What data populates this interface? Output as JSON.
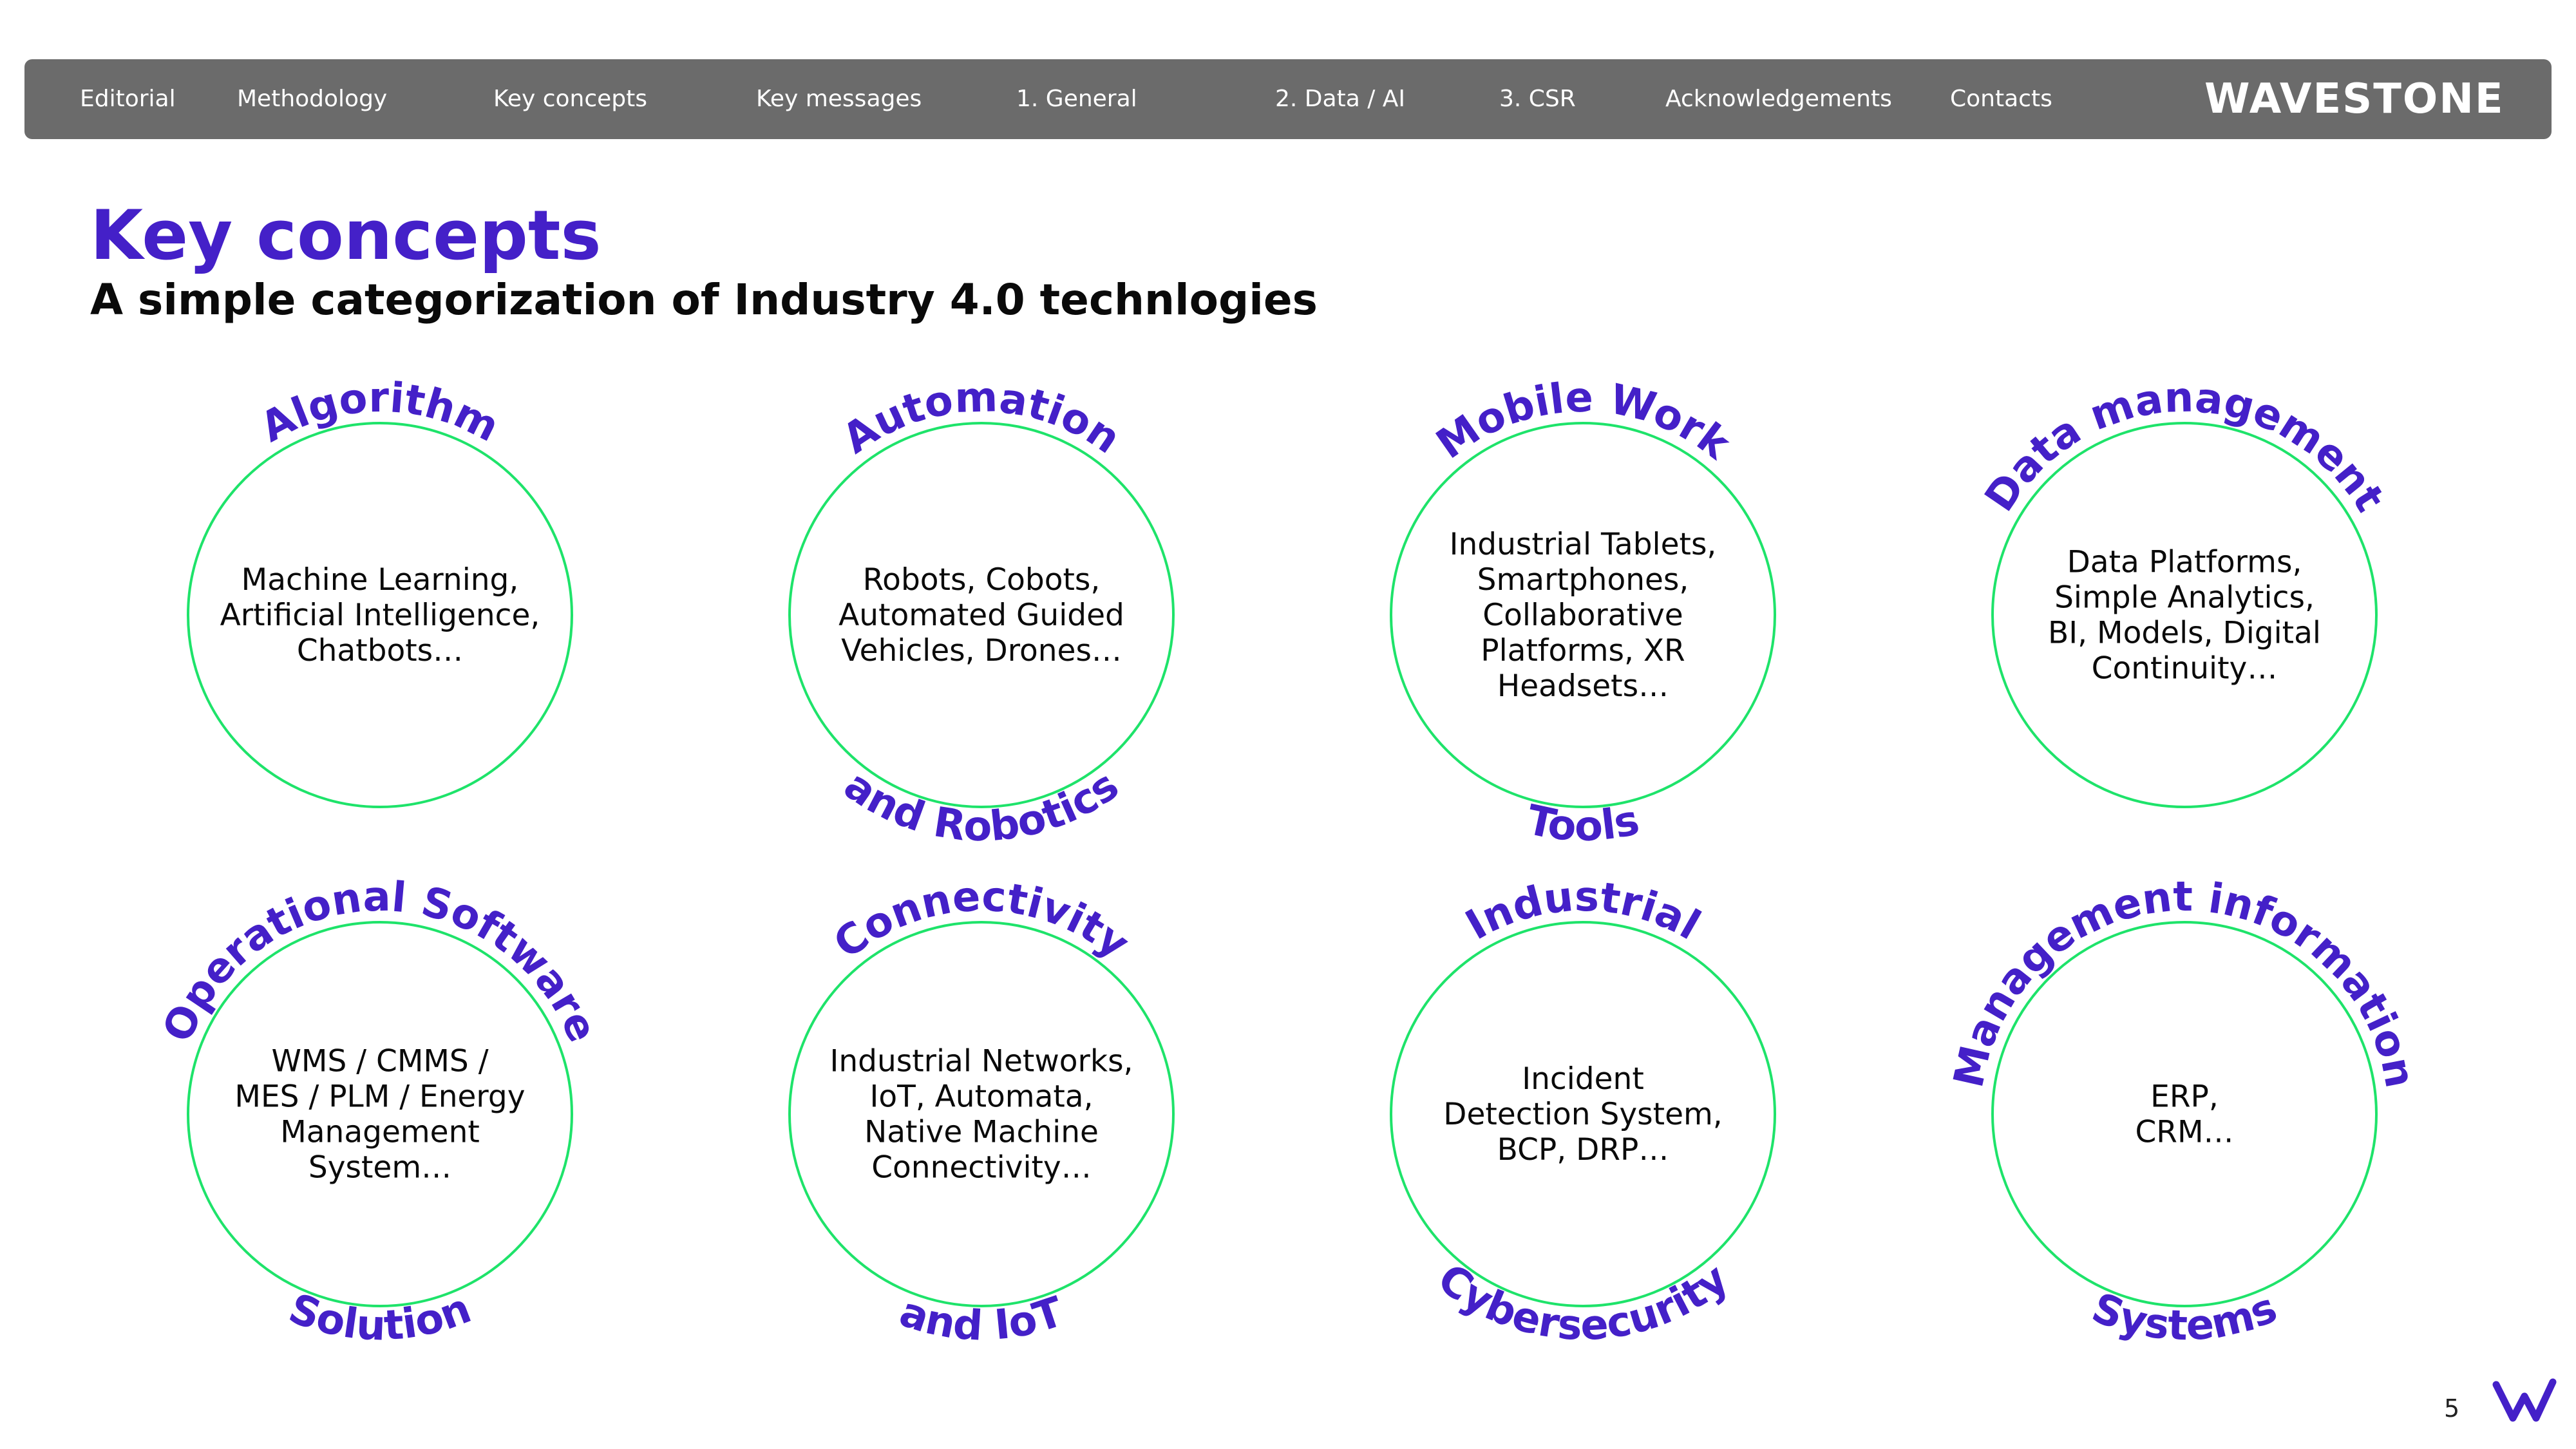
{
  "nav": {
    "items": [
      {
        "label": "Editorial",
        "active": false
      },
      {
        "label": "Methodology",
        "active": false
      },
      {
        "label": "Key concepts",
        "active": true
      },
      {
        "label": "Key messages",
        "active": false
      },
      {
        "label": "1. General",
        "active": false
      },
      {
        "label": "2. Data  / AI",
        "active": false
      },
      {
        "label": "3. CSR",
        "active": false
      },
      {
        "label": "Acknowledgements",
        "active": false
      },
      {
        "label": "Contacts",
        "active": false
      }
    ],
    "logo": "WAVESTONE"
  },
  "page": {
    "title": "Key concepts",
    "subtitle": "A simple categorization of Industry 4.0 technlogies",
    "number": "5"
  },
  "concepts": [
    {
      "top": "Algorithm",
      "bottom": "",
      "body": [
        "Machine Learning,",
        "Artificial Intelligence,",
        "Chatbots…"
      ]
    },
    {
      "top": "Automation",
      "bottom": "and Robotics",
      "body": [
        "Robots, Cobots,",
        "Automated Guided",
        "Vehicles, Drones…"
      ]
    },
    {
      "top": "Mobile Work",
      "bottom": "Tools",
      "body": [
        "Industrial Tablets,",
        "Smartphones,",
        "Collaborative",
        "Platforms, XR",
        "Headsets…"
      ]
    },
    {
      "top": "Data management",
      "bottom": "",
      "body": [
        "Data Platforms,",
        "Simple Analytics,",
        "BI, Models, Digital",
        "Continuity…"
      ]
    },
    {
      "top": "Operational Software",
      "bottom": "Solution",
      "body": [
        "WMS / CMMS /",
        "MES / PLM / Energy",
        "Management",
        "System…"
      ]
    },
    {
      "top": "Connectivity",
      "bottom": "and IoT",
      "body": [
        "Industrial Networks,",
        "IoT, Automata,",
        "Native Machine",
        "Connectivity…"
      ]
    },
    {
      "top": "Industrial",
      "bottom": "Cybersecurity",
      "body": [
        "Incident",
        "Detection System,",
        "BCP, DRP…"
      ]
    },
    {
      "top": "Management information",
      "bottom": "Systems",
      "body": [
        "ERP,",
        "CRM…"
      ]
    }
  ],
  "colors": {
    "accent": "#4420c8",
    "ring": "#1ee36a",
    "nav_bg": "#6b6b6b",
    "nav_active": "#1ee36a"
  },
  "icons": {
    "footer_logo": "wavestone-w-icon"
  }
}
